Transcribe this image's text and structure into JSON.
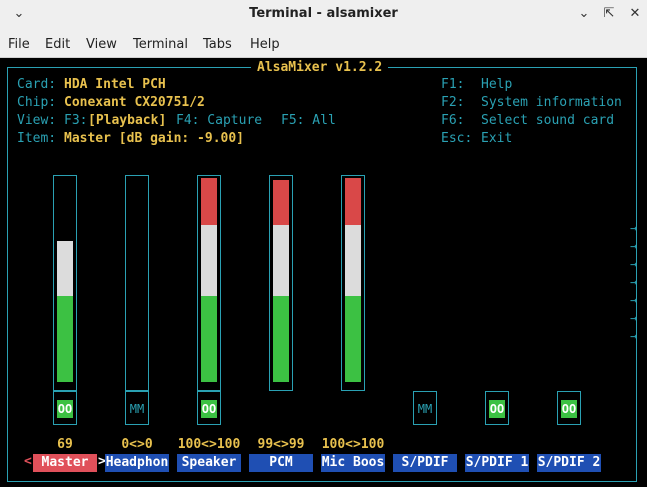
{
  "window": {
    "title": "Terminal - alsamixer",
    "chevron_icon": "chevron-down-icon",
    "min_icon": "minimize-icon",
    "max_icon": "maximize-icon",
    "close_icon": "close-icon"
  },
  "menu": [
    "File",
    "Edit",
    "View",
    "Terminal",
    "Tabs",
    "Help"
  ],
  "mixer": {
    "title": "AlsaMixer v1.2.2",
    "card_label": "Card:",
    "card": "HDA Intel PCH",
    "chip_label": "Chip:",
    "chip": "Conexant CX20751/2",
    "view_label": "View:",
    "view_f3": "F3:",
    "view_playback": "[Playback]",
    "view_f4": "F4: Capture",
    "view_f5": "F5: All",
    "item_label": "Item:",
    "item": "Master [dB gain: -9.00]",
    "help": [
      {
        "key": "F1:",
        "text": "Help"
      },
      {
        "key": "F2:",
        "text": "System information"
      },
      {
        "key": "F6:",
        "text": "Select sound card"
      },
      {
        "key": "Esc:",
        "text": "Exit"
      }
    ],
    "right_arrow": "→",
    "left_marker": "<",
    "right_marker": ">",
    "controls": [
      {
        "name": "Master",
        "value": "69",
        "level": 0.69,
        "mute": "OO",
        "muted": false,
        "selected": true,
        "has_slider": true
      },
      {
        "name": "Headphon",
        "value": "0<>0",
        "level": 0,
        "mute": "MM",
        "muted": true,
        "selected": false,
        "has_slider": true
      },
      {
        "name": "Speaker",
        "value": "100<>100",
        "level": 1.0,
        "mute": "OO",
        "muted": false,
        "selected": false,
        "has_slider": true
      },
      {
        "name": "PCM",
        "value": "99<>99",
        "level": 0.99,
        "mute": "",
        "muted": false,
        "selected": false,
        "has_slider": true
      },
      {
        "name": "Mic Boos",
        "value": "100<>100",
        "level": 1.0,
        "mute": "",
        "muted": false,
        "selected": false,
        "has_slider": true
      },
      {
        "name": "S/PDIF",
        "value": "",
        "level": null,
        "mute": "MM",
        "muted": true,
        "selected": false,
        "has_slider": false
      },
      {
        "name": "S/PDIF 1",
        "value": "",
        "level": null,
        "mute": "OO",
        "muted": false,
        "selected": false,
        "has_slider": false
      },
      {
        "name": "S/PDIF 2",
        "value": "",
        "level": null,
        "mute": "OO",
        "muted": false,
        "selected": false,
        "has_slider": false
      }
    ],
    "colors": {
      "green": "#3cc143",
      "white": "#dcdcdc",
      "red": "#d94848",
      "frame": "#2aa1b3",
      "label_bg": "#1f4fb3",
      "selected_bg": "#e0505a",
      "value": "#e8c14e"
    }
  }
}
